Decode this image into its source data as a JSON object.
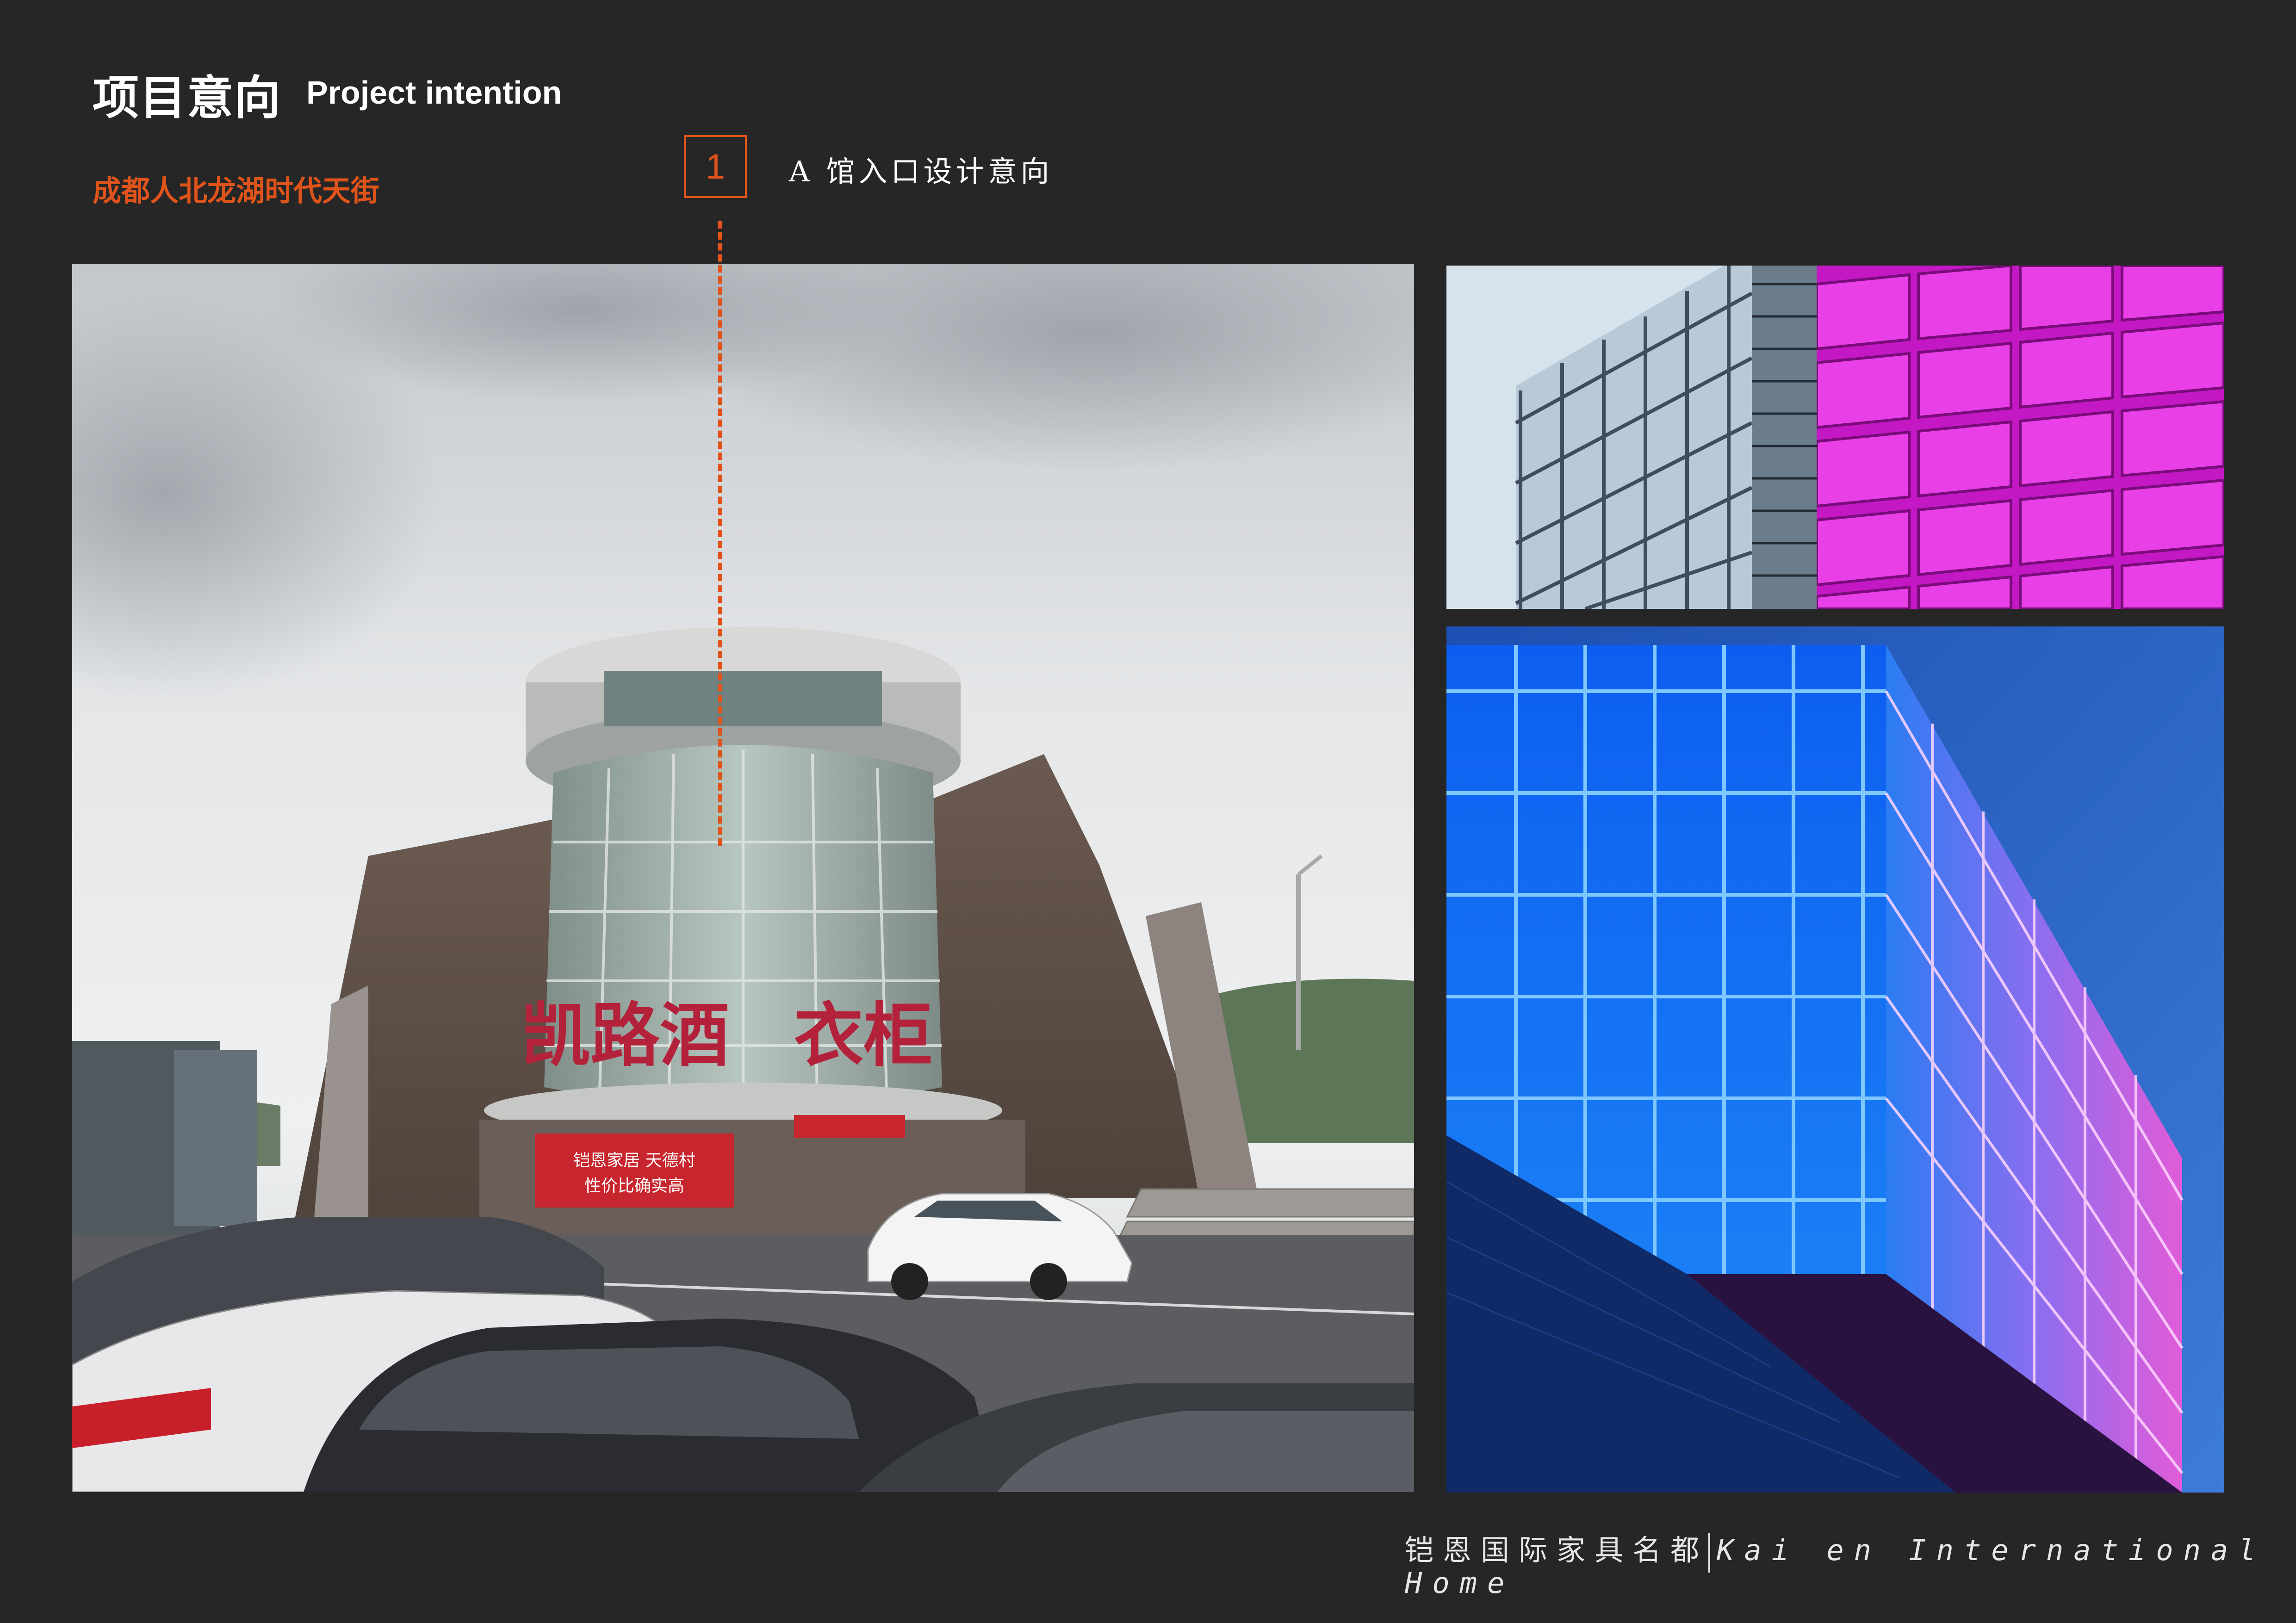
{
  "header": {
    "title_cn": "项目意向",
    "title_en": "Project intention",
    "subtitle": "成都人北龙湖时代天街"
  },
  "section": {
    "number": "1",
    "label": "A 馆入口设计意向"
  },
  "main_photo": {
    "sign_text": "凯路酒 衣柜",
    "banner_text_1": "铠恩家居 天德村",
    "banner_text_2": "性价比确实高"
  },
  "footer": {
    "brand_cn": "铠恩国际家具名都",
    "brand_en_line1": "Kai en International",
    "brand_en_line2": "Home"
  },
  "colors": {
    "background": "#262626",
    "accent": "#e0541b",
    "text": "#ffffff"
  }
}
